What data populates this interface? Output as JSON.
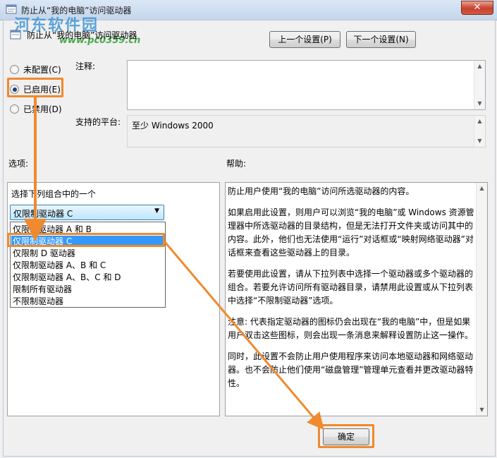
{
  "window": {
    "title": "防止从“我的电脑”访问驱动器",
    "close_glyph": "✕"
  },
  "watermark": {
    "text": "河东软件园",
    "url": "www.pc0359.cn"
  },
  "header": {
    "policy_title": "防止从“我的电脑”访问驱动器"
  },
  "nav": {
    "prev": "上一个设置(P)",
    "next": "下一个设置(N)"
  },
  "state": {
    "options": [
      {
        "label": "未配置(C)",
        "checked": false
      },
      {
        "label": "已启用(E)",
        "checked": true
      },
      {
        "label": "已禁用(D)",
        "checked": false
      }
    ]
  },
  "comment": {
    "label": "注释:",
    "value": ""
  },
  "platform": {
    "label": "支持的平台:",
    "value": "至少 Windows 2000"
  },
  "options_section": {
    "label": "选项:",
    "prompt": "选择下列组合中的一个",
    "selected": "仅限制驱动器 C",
    "items": [
      "仅限制驱动器 A 和 B",
      "仅限制驱动器 C",
      "仅限制 D 驱动器",
      "仅限制驱动器 A、B 和 C",
      "仅限制驱动器 A、B、C 和 D",
      "限制所有驱动器",
      "不限制驱动器"
    ],
    "selected_index": 1
  },
  "help": {
    "label": "帮助:",
    "paragraphs": [
      "防止用户使用“我的电脑”访问所选驱动器的内容。",
      "如果启用此设置，则用户可以浏览“我的电脑”或 Windows 资源管理器中所选驱动器的目录结构，但是无法打开文件夹或访问其中的内容。此外，他们也无法使用“运行”对话框或“映射网络驱动器”对话框来查看这些驱动器上的目录。",
      "若要使用此设置，请从下拉列表中选择一个驱动器或多个驱动器的组合。若要允许访问所有驱动器目录，请禁用此设置或从下拉列表中选择“不限制驱动器”选项。",
      "注意: 代表指定驱动器的图标仍会出现在“我的电脑”中，但是如果用户双击这些图标，则会出现一条消息来解释设置防止这一操作。",
      "同时，此设置不会防止用户使用程序来访问本地驱动器和网络驱动器。也不会防止他们使用“磁盘管理”管理单元查看并更改驱动器特性。"
    ]
  },
  "footer": {
    "ok": "确定"
  },
  "colors": {
    "annotation": "#ef8a2e",
    "selection": "#3399ff"
  }
}
